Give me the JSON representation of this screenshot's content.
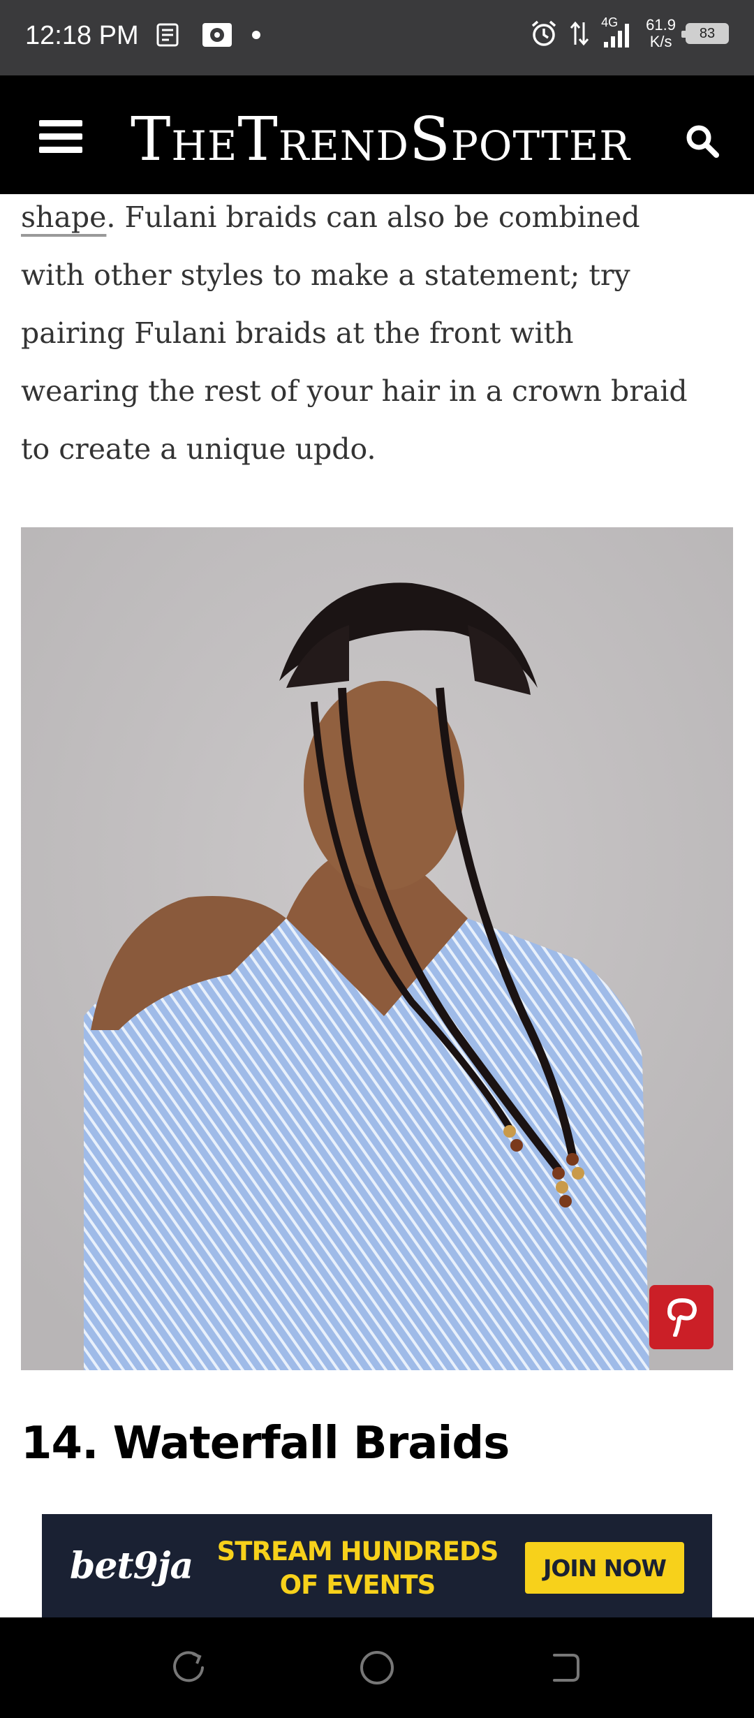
{
  "status_bar": {
    "time": "12:18 PM",
    "network": "4G",
    "speed_value": "61.9",
    "speed_unit": "K/s",
    "battery": "83"
  },
  "header": {
    "logo_text": "TheTrendSpotter",
    "logo_parts": [
      "T",
      "HE",
      "T",
      "REND",
      "S",
      "POTTER"
    ],
    "menu_icon": "hamburger-menu-icon",
    "search_icon": "search-icon"
  },
  "article": {
    "link_word": "shape",
    "paragraph_lines": [
      ". Fulani braids can also be combined",
      "with other styles to make a statement; try",
      "pairing Fulani braids at the front with",
      "wearing the rest of your hair in a crown braid",
      "to create a unique updo."
    ],
    "pin_icon": "pinterest-icon",
    "section_heading": "14. Waterfall Braids"
  },
  "ad": {
    "brand": "bet9ja",
    "headline_line1": "STREAM HUNDREDS",
    "headline_line2": "OF EVENTS",
    "cta": "JOIN NOW",
    "colors": {
      "background": "#1a2133",
      "accent": "#f7d11b"
    }
  },
  "nav_bar": {
    "recent_icon": "recent-apps-icon",
    "home_icon": "home-icon",
    "back_icon": "back-icon"
  }
}
